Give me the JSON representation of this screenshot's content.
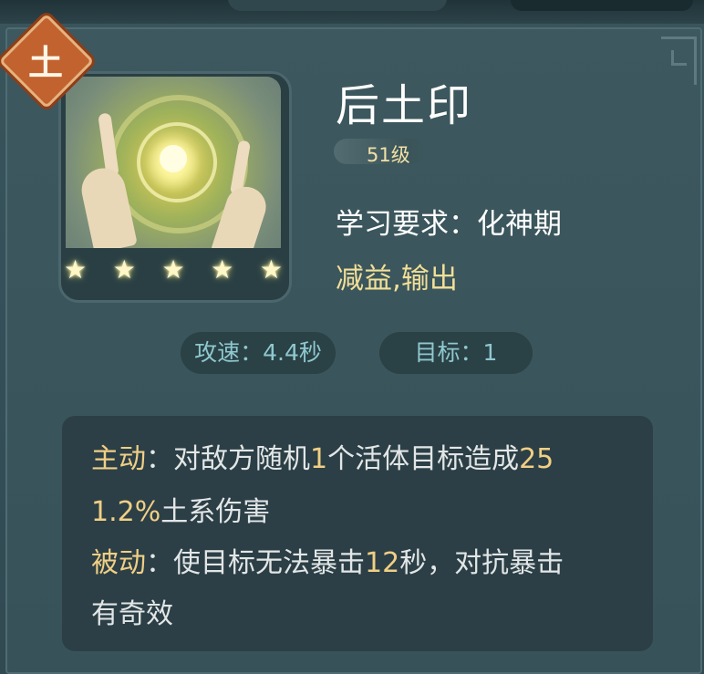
{
  "element_badge": "土",
  "skill": {
    "name": "后土印",
    "level": "51级",
    "requirement": "学习要求：化神期",
    "tags": "减益,输出",
    "stars": [
      "★",
      "★",
      "★",
      "★",
      "★"
    ]
  },
  "stats": {
    "attack_speed": "攻速：4.4秒",
    "target": "目标：1"
  },
  "description": {
    "active_label": "主动",
    "active_text_a": "：对敌方随机",
    "active_num_a": "1",
    "active_text_b": "个活体目标造成",
    "active_num_b": "25",
    "active_num_c": "1.2%",
    "active_text_c": "土系伤害",
    "passive_label": "被动",
    "passive_text_a": "：使目标无法暴击",
    "passive_num": "12",
    "passive_text_b": "秒，对抗暴击",
    "passive_text_c": "有奇效"
  },
  "colors": {
    "highlight": "#f0cf85",
    "element_badge_bg": "#c1622f",
    "stat_text": "#8fc8cf"
  },
  "icons": [
    "element-earth-badge",
    "skill-art-icon",
    "star-icon",
    "corner-ornament"
  ]
}
